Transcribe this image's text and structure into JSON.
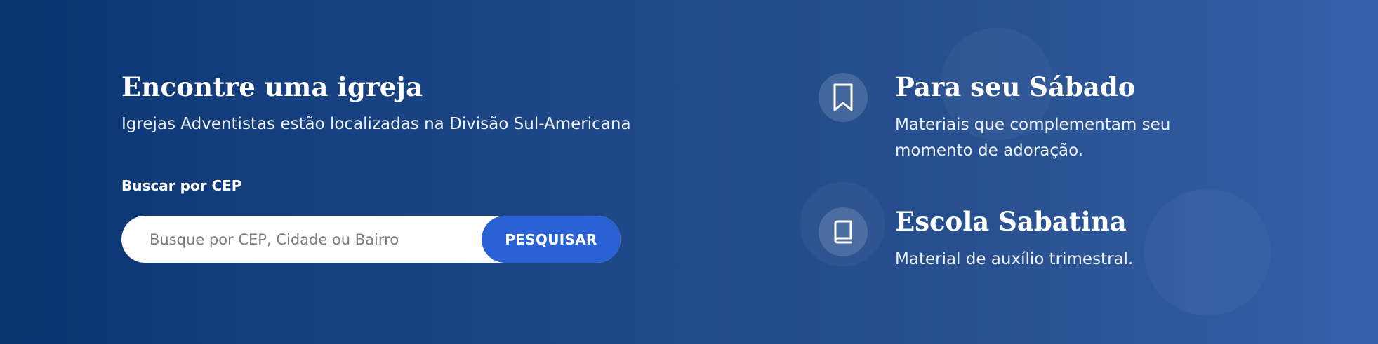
{
  "find_church": {
    "title": "Encontre uma igreja",
    "subtitle": "Igrejas Adventistas estão localizadas na Divisão Sul-Americana",
    "search_label": "Buscar por CEP",
    "search_placeholder": "Busque por CEP, Cidade ou Bairro",
    "search_value": "",
    "button_label": "PESQUISAR"
  },
  "features": [
    {
      "icon": "bookmark-icon",
      "title": "Para seu Sábado",
      "description": "Materiais que complementam seu momento de adoração."
    },
    {
      "icon": "book-icon",
      "title": "Escola Sabatina",
      "description": "Material de auxílio trimestral."
    }
  ],
  "colors": {
    "background_start": "#0b3571",
    "background_end": "#3560a8",
    "button": "#2a62d6",
    "input_background": "#ffffff"
  }
}
